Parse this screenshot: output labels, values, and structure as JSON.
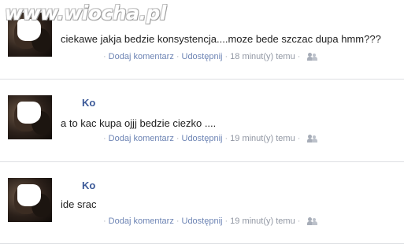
{
  "watermark": "www.wiocha.pl",
  "posts": [
    {
      "name": "",
      "message": "ciekawe jakja bedzie konsystencja....moze bede szczac dupa hmm???",
      "comment_label": "Dodaj komentarz",
      "share_label": "Udostępnij",
      "time": "18 minut(y) temu"
    },
    {
      "name": "Ko",
      "message": "a to kac kupa ojjj bedzie ciezko ....",
      "comment_label": "Dodaj komentarz",
      "share_label": "Udostępnij",
      "time": "19 minut(y) temu"
    },
    {
      "name": "Ko",
      "message": "ide srac",
      "comment_label": "Dodaj komentarz",
      "share_label": "Udostępnij",
      "time": "19 minut(y) temu"
    }
  ],
  "colors": {
    "link": "#6d84b4",
    "name": "#3b5998",
    "meta": "#9197a3",
    "divider": "#dddfe2"
  },
  "icons": {
    "audience": "people-icon"
  }
}
